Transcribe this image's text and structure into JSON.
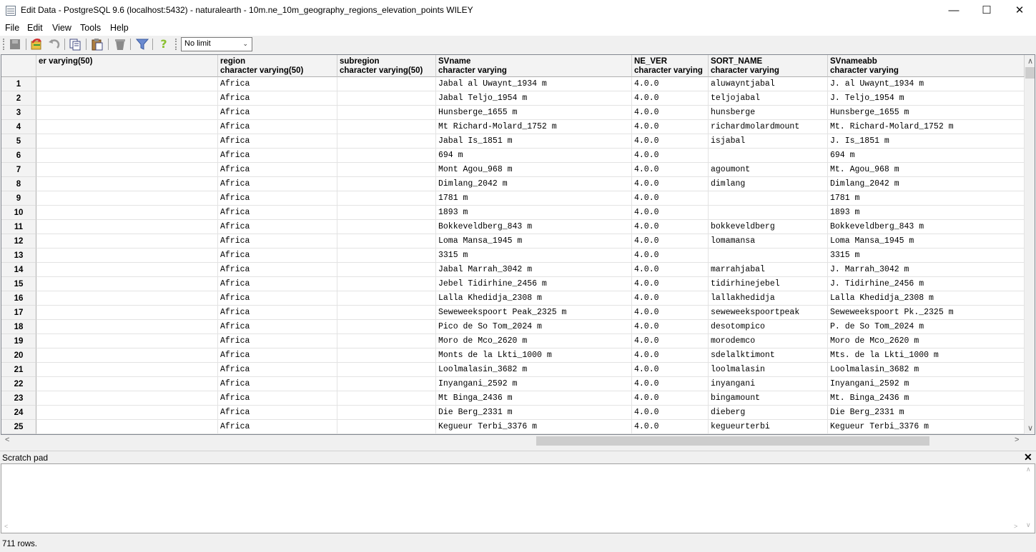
{
  "window": {
    "title": "Edit Data - PostgreSQL 9.6 (localhost:5432) - naturalearth - 10m.ne_10m_geography_regions_elevation_points WILEY",
    "minimize": "—",
    "maximize": "☐",
    "close": "✕"
  },
  "menu": {
    "items": [
      "File",
      "Edit",
      "View",
      "Tools",
      "Help"
    ]
  },
  "toolbar": {
    "limit_value": "No limit"
  },
  "grid": {
    "headers": [
      {
        "name": "",
        "type": "er varying(50)"
      },
      {
        "name": "region",
        "type": "character varying(50)"
      },
      {
        "name": "subregion",
        "type": "character varying(50)"
      },
      {
        "name": "SVname",
        "type": "character varying"
      },
      {
        "name": "NE_VER",
        "type": "character varying"
      },
      {
        "name": "SORT_NAME",
        "type": "character varying"
      },
      {
        "name": "SVnameabb",
        "type": "character varying"
      }
    ],
    "rows": [
      [
        "1",
        "",
        "Africa",
        "",
        "Jabal al Uwaynt_1934 m",
        "4.0.0",
        "aluwayntjabal",
        "J. al Uwaynt_1934 m"
      ],
      [
        "2",
        "",
        "Africa",
        "",
        "Jabal Teljo_1954 m",
        "4.0.0",
        "teljojabal",
        "J. Teljo_1954 m"
      ],
      [
        "3",
        "",
        "Africa",
        "",
        "Hunsberge_1655 m",
        "4.0.0",
        "hunsberge",
        "Hunsberge_1655 m"
      ],
      [
        "4",
        "",
        "Africa",
        "",
        "Mt Richard-Molard_1752 m",
        "4.0.0",
        "richardmolardmount",
        "Mt. Richard-Molard_1752 m"
      ],
      [
        "5",
        "",
        "Africa",
        "",
        "Jabal Is_1851 m",
        "4.0.0",
        "isjabal",
        "J. Is_1851 m"
      ],
      [
        "6",
        "",
        "Africa",
        "",
        "694 m",
        "4.0.0",
        "",
        "694 m"
      ],
      [
        "7",
        "",
        "Africa",
        "",
        "Mont Agou_968 m",
        "4.0.0",
        "agoumont",
        "Mt. Agou_968 m"
      ],
      [
        "8",
        "",
        "Africa",
        "",
        "Dimlang_2042 m",
        "4.0.0",
        "dimlang",
        "Dimlang_2042 m"
      ],
      [
        "9",
        "",
        "Africa",
        "",
        "1781 m",
        "4.0.0",
        "",
        "1781 m"
      ],
      [
        "10",
        "",
        "Africa",
        "",
        "1893 m",
        "4.0.0",
        "",
        "1893 m"
      ],
      [
        "11",
        "",
        "Africa",
        "",
        "Bokkeveldberg_843 m",
        "4.0.0",
        "bokkeveldberg",
        "Bokkeveldberg_843 m"
      ],
      [
        "12",
        "",
        "Africa",
        "",
        "Loma Mansa_1945 m",
        "4.0.0",
        "lomamansa",
        "Loma Mansa_1945 m"
      ],
      [
        "13",
        "",
        "Africa",
        "",
        "3315 m",
        "4.0.0",
        "",
        "3315 m"
      ],
      [
        "14",
        "",
        "Africa",
        "",
        "Jabal Marrah_3042 m",
        "4.0.0",
        "marrahjabal",
        "J. Marrah_3042 m"
      ],
      [
        "15",
        "",
        "Africa",
        "",
        "Jebel Tidirhine_2456 m",
        "4.0.0",
        "tidirhinejebel",
        "J. Tidirhine_2456 m"
      ],
      [
        "16",
        "",
        "Africa",
        "",
        "Lalla Khedidja_2308 m",
        "4.0.0",
        "lallakhedidja",
        "Lalla Khedidja_2308 m"
      ],
      [
        "17",
        "",
        "Africa",
        "",
        "Seweweekspoort Peak_2325 m",
        "4.0.0",
        "seweweekspoortpeak",
        "Seweweekspoort Pk._2325 m"
      ],
      [
        "18",
        "",
        "Africa",
        "",
        "Pico de So Tom_2024 m",
        "4.0.0",
        "desotompico",
        "P. de So Tom_2024 m"
      ],
      [
        "19",
        "",
        "Africa",
        "",
        "Moro de Mco_2620 m",
        "4.0.0",
        "morodemco",
        "Moro de Mco_2620 m"
      ],
      [
        "20",
        "",
        "Africa",
        "",
        "Monts de la Lkti_1000 m",
        "4.0.0",
        "sdelalktimont",
        "Mts. de la Lkti_1000 m"
      ],
      [
        "21",
        "",
        "Africa",
        "",
        "Loolmalasin_3682 m",
        "4.0.0",
        "loolmalasin",
        "Loolmalasin_3682 m"
      ],
      [
        "22",
        "",
        "Africa",
        "",
        "Inyangani_2592 m",
        "4.0.0",
        "inyangani",
        "Inyangani_2592 m"
      ],
      [
        "23",
        "",
        "Africa",
        "",
        "Mt Binga_2436 m",
        "4.0.0",
        "bingamount",
        "Mt. Binga_2436 m"
      ],
      [
        "24",
        "",
        "Africa",
        "",
        "Die Berg_2331 m",
        "4.0.0",
        "dieberg",
        "Die Berg_2331 m"
      ],
      [
        "25",
        "",
        "Africa",
        "",
        "Kegueur Terbi_3376 m",
        "4.0.0",
        "kegueurterbi",
        "Kegueur Terbi_3376 m"
      ]
    ]
  },
  "scratch_pad": {
    "label": "Scratch pad"
  },
  "status": {
    "text": "711 rows."
  },
  "icons": [
    "save-icon",
    "refresh-icon",
    "undo-icon",
    "copy-icon",
    "paste-icon",
    "delete-icon",
    "filter-icon",
    "help-icon",
    "limit-dropdown-arrow-icon"
  ]
}
